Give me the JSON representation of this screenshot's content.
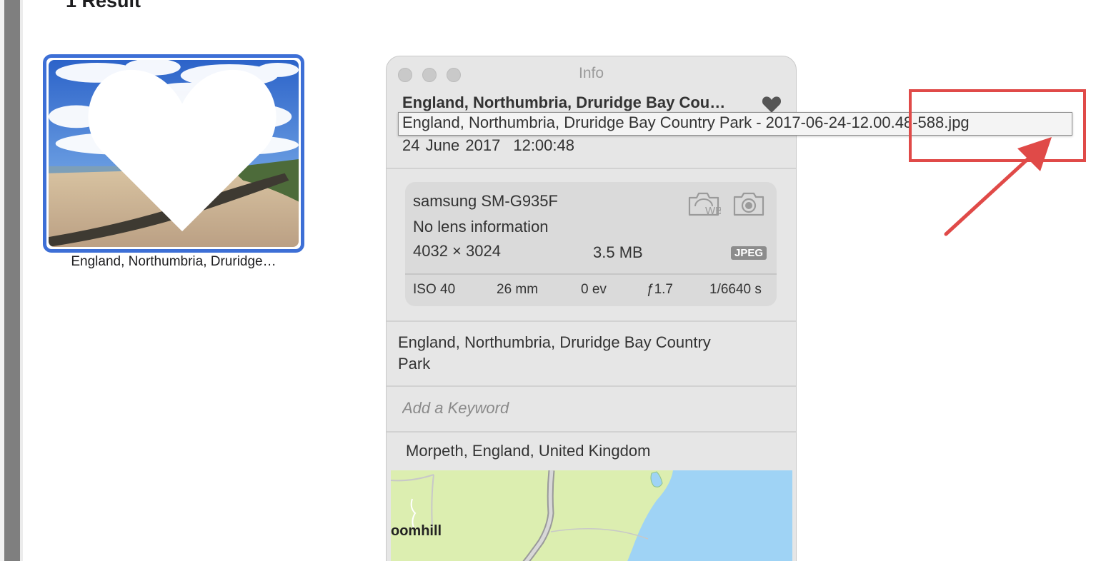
{
  "results": {
    "title": "1 Result"
  },
  "grid": {
    "items": [
      {
        "caption": "England, Northumbria, Druridge…",
        "favorite": true,
        "selected": true
      }
    ]
  },
  "info_panel": {
    "window_title": "Info",
    "photo_title": "England, Northumbria, Druridge Bay Cou…",
    "favorite": true,
    "filename_tooltip": "England, Northumbria, Druridge Bay Country Park - 2017-06-24-12.00.48-588.jpg",
    "date": "24 June 2017",
    "time": "12:00:48",
    "camera": {
      "model": "samsung SM-G935F",
      "lens": "No lens information",
      "dimensions": "4032 × 3024",
      "file_size": "3.5 MB",
      "format": "JPEG",
      "wb_icon_label": "WB",
      "exif": {
        "iso": "ISO 40",
        "focal_length": "26 mm",
        "exposure_bias": "0 ev",
        "aperture": "ƒ1.7",
        "shutter": "1/6640 s"
      }
    },
    "location_name": "England, Northumbria, Druridge Bay Country Park",
    "keyword_placeholder": "Add a Keyword",
    "place": "Morpeth, England, United Kingdom",
    "map": {
      "label": "oomhill"
    }
  },
  "colors": {
    "selection": "#3d6fd6",
    "annotation": "#e04a48",
    "panel_bg": "#e6e6e6",
    "map_land": "#dceeb0",
    "map_sea": "#9fd3f5"
  },
  "icons": [
    "heart-icon",
    "white-balance-icon",
    "camera-icon"
  ]
}
